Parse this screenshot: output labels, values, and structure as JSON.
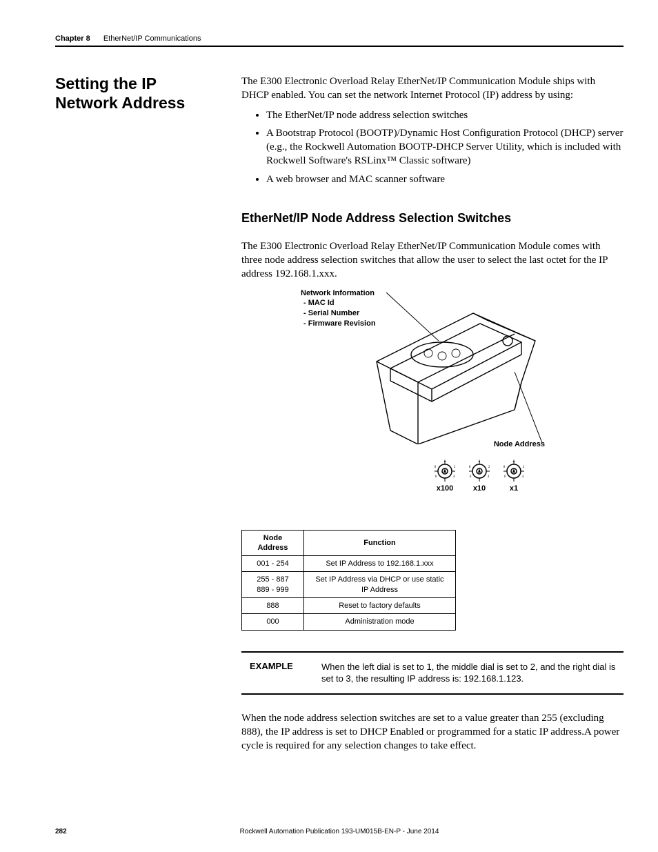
{
  "header": {
    "chapter_label": "Chapter 8",
    "chapter_title": "EtherNet/IP Communications"
  },
  "section": {
    "heading": "Setting the IP Network Address",
    "intro": "The E300 Electronic Overload Relay EtherNet/IP Communication Module ships with DHCP enabled. You can set the network Internet Protocol (IP) address by using:",
    "bullets": [
      "The EtherNet/IP node address selection switches",
      "A Bootstrap Protocol (BOOTP)/Dynamic Host Configuration Protocol (DHCP) server (e.g., the Rockwell Automation BOOTP-DHCP Server Utility, which is included with Rockwell Software's RSLinx™ Classic software)",
      "A web browser and MAC scanner software"
    ]
  },
  "sub": {
    "heading": "EtherNet/IP Node Address Selection Switches",
    "para": "The E300 Electronic Overload Relay EtherNet/IP Communication Module comes with three node address selection switches that allow the user to select the last octet for the IP address 192.168.1.xxx."
  },
  "diagram": {
    "network_info_title": "Network Information",
    "network_info_items": [
      "- MAC Id",
      "- Serial Number",
      "- Firmware Revision"
    ],
    "node_address_label": "Node Address",
    "dials": [
      "x100",
      "x10",
      "x1"
    ],
    "dial_ticks": [
      "0",
      "2",
      "4",
      "6",
      "8"
    ]
  },
  "table": {
    "headers": [
      "Node Address",
      "Function"
    ],
    "rows": [
      [
        "001 - 254",
        "Set IP Address to 192.168.1.xxx"
      ],
      [
        "255 - 887\n889 - 999",
        "Set IP Address via DHCP or use static IP Address"
      ],
      [
        "888",
        "Reset to factory defaults"
      ],
      [
        "000",
        "Administration mode"
      ]
    ]
  },
  "example": {
    "label": "EXAMPLE",
    "text": "When the left dial is set to 1, the middle dial is set to 2, and the right dial is set to 3, the resulting IP address is: 192.168.1.123."
  },
  "closing": "When the node address selection switches are set to a value greater than 255 (excluding 888), the IP address is set to DHCP Enabled or programmed for a static IP address.A power cycle is required for any selection changes to take effect.",
  "footer": {
    "page": "282",
    "pub": "Rockwell Automation Publication 193-UM015B-EN-P - June 2014"
  }
}
